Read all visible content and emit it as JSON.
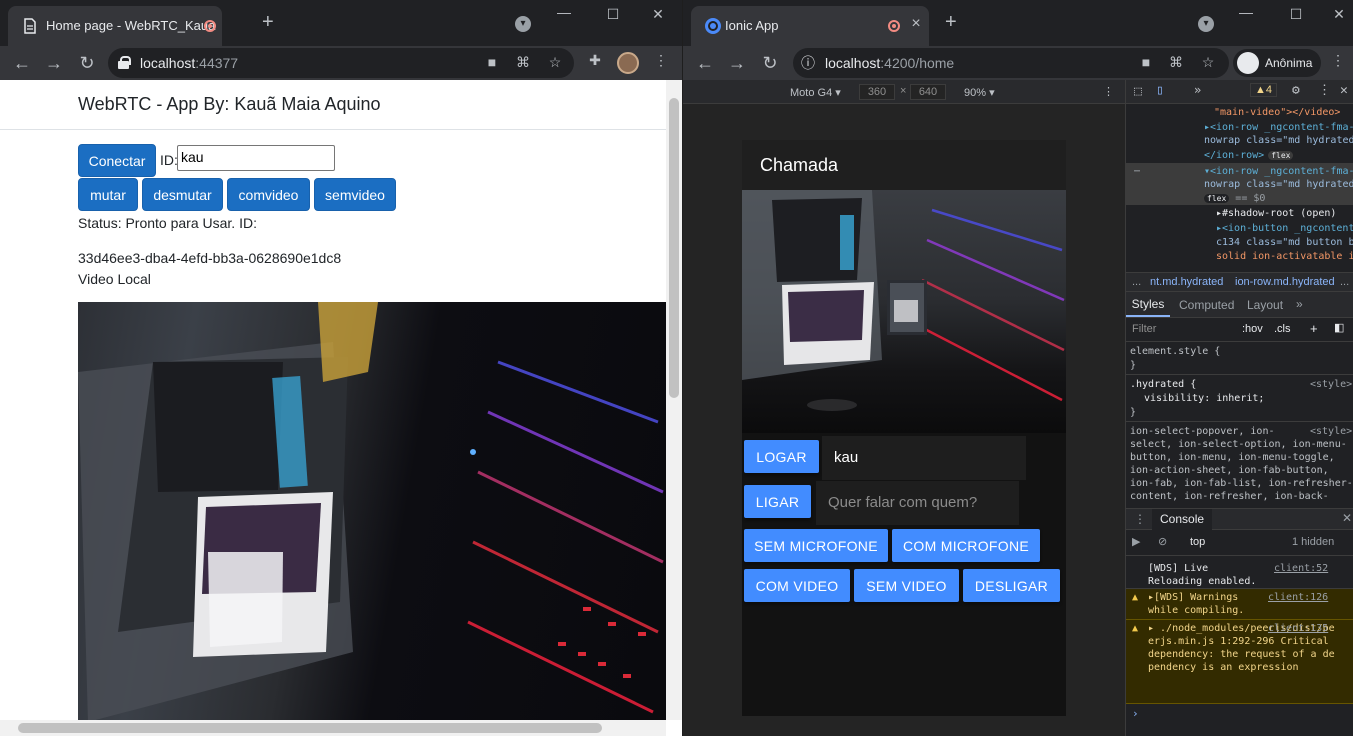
{
  "left_window": {
    "tab_title": "Home page - WebRTC_Kaua",
    "url_host": "localhost",
    "url_rest": ":44377",
    "page": {
      "brand": "WebRTC - App By: Kauã Maia Aquino",
      "connect_label": "Conectar",
      "id_label": "ID:",
      "id_value": "kau",
      "buttons": [
        "mutar",
        "desmutar",
        "comvideo",
        "semvideo"
      ],
      "status": "Status: Pronto para Usar. ID:",
      "peer_id": "33d46ee3-dba4-4efd-bb3a-0628690e1dc8",
      "video_label": "Video Local"
    }
  },
  "right_window": {
    "tab_title": "Ionic App",
    "url_host": "localhost",
    "url_rest": ":4200/home",
    "profile_label": "Anônima",
    "device_toolbar": {
      "device": "Moto G4",
      "width": "360",
      "height": "640",
      "zoom": "90%"
    },
    "app": {
      "header_title": "Chamada",
      "login_label": "LOGAR",
      "login_value": "kau",
      "call_label": "LIGAR",
      "call_placeholder": "Quer falar com quem?",
      "buttons_row1": [
        "SEM MICROFONE",
        "COM MICROFONE"
      ],
      "buttons_row2": [
        "COM VIDEO",
        "SEM VIDEO",
        "DESLIGAR"
      ]
    },
    "devtools": {
      "warn_count": "4",
      "elements": [
        "\"main-video\"></video>",
        "▸<ion-row _ngcontent-fma-",
        "nowrap class=\"md hydrated",
        "</ion-row>",
        "▾<ion-row _ngcontent-fma-",
        "nowrap class=\"md hydrated",
        "== $0",
        "▸#shadow-root (open)",
        "▸<ion-button _ngcontent",
        "c134 class=\"md button bu",
        "solid ion-activatable io"
      ],
      "flex_badge": "flex",
      "breadcrumbs": [
        "...",
        "nt.md.hydrated",
        "ion-row.md.hydrated",
        "..."
      ],
      "style_tabs": [
        "Styles",
        "Computed",
        "Layout"
      ],
      "filter_placeholder": "Filter",
      "hov": ":hov",
      "cls": ".cls",
      "styles": [
        "element.style {",
        "}",
        ".hydrated {",
        "<style>",
        "visibility: inherit;",
        "}",
        "ion-select-popover, ion-",
        "<style>",
        "select, ion-select-option, ion-menu-",
        "button, ion-menu, ion-menu-toggle,",
        "ion-action-sheet, ion-fab-button,",
        "ion-fab, ion-fab-list, ion-refresher-",
        "content, ion-refresher, ion-back-"
      ],
      "console_tab": "Console",
      "context": "top",
      "hidden_count": "1 hidden",
      "messages": [
        {
          "text": "[WDS] Live Reloading enabled.",
          "link": "client:52",
          "level": "info"
        },
        {
          "text": "▸[WDS] Warnings while compiling.",
          "link": "client:126",
          "level": "warning"
        },
        {
          "text": "▸ ./node_modules/peerjs/dist/peerjs.min.js 1:292-296 Critical dependency: the request of a dependency is an expression",
          "link": "client:135",
          "level": "warning"
        }
      ]
    }
  },
  "colors": {
    "bootstrap_primary": "#1b6ec2",
    "ionic_primary": "#428cff",
    "chrome_dark": "#202124"
  }
}
